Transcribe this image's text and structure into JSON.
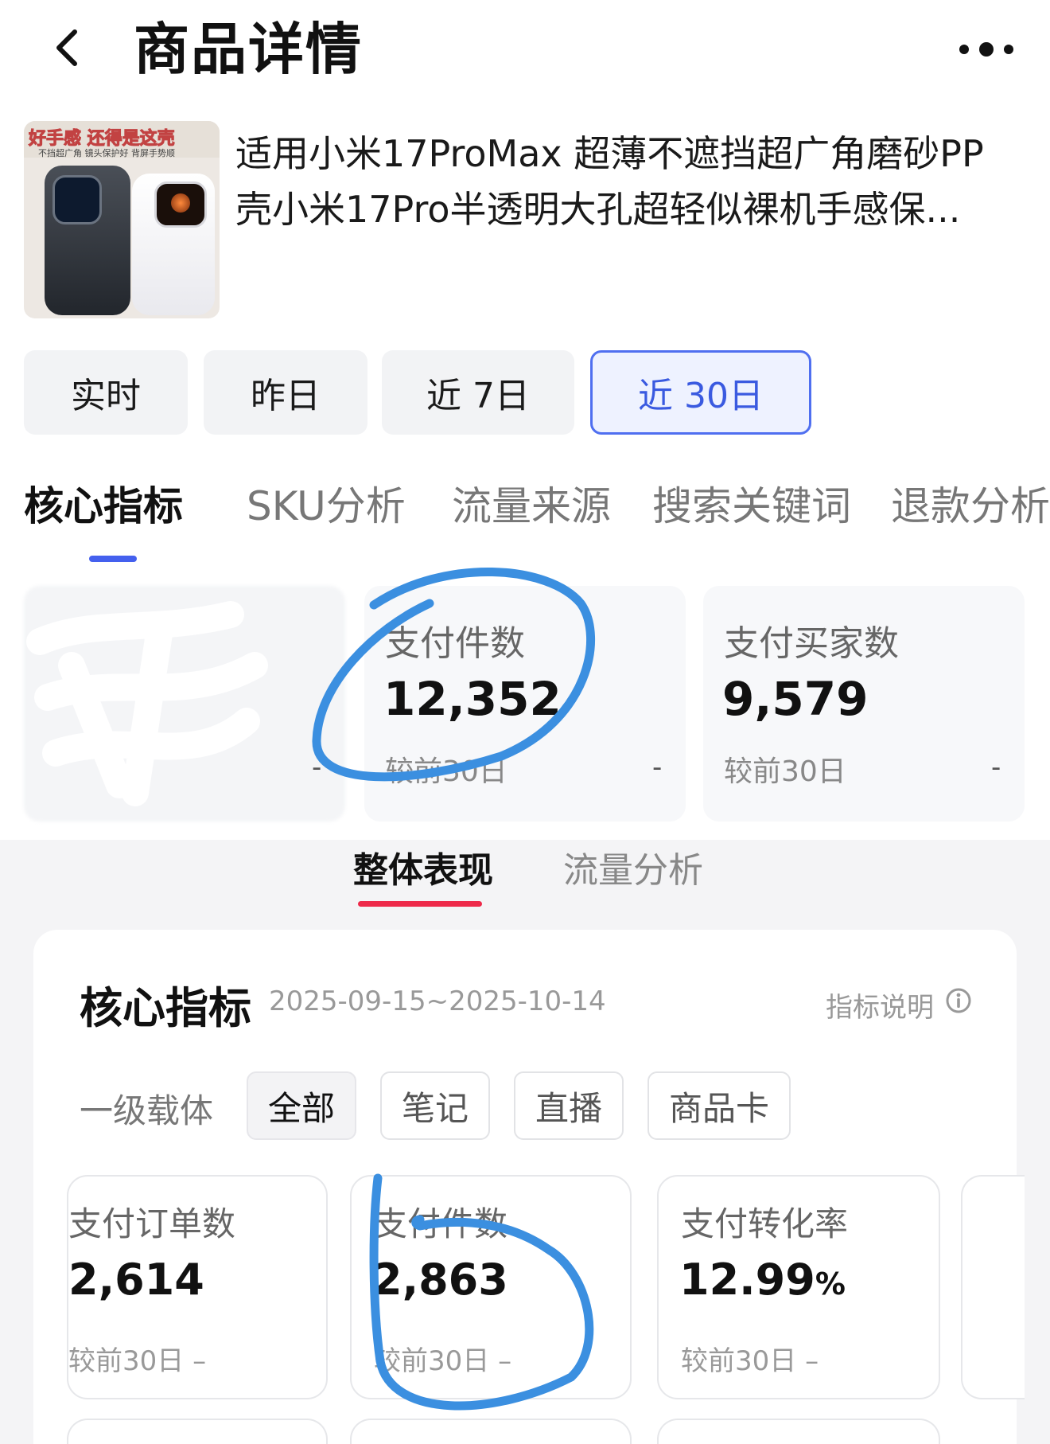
{
  "header": {
    "title": "商品详情"
  },
  "product": {
    "title_line1": "适用小米17ProMax 超薄不遮挡超广角磨砂PP",
    "title_line2": "壳小米17Pro半透明大孔超轻似裸机手感保...",
    "thumb_text1": "好手感 还得是这壳",
    "thumb_text2": "不挡超广角  镜头保护好  背屏手势顺"
  },
  "periods": [
    {
      "label": "实时",
      "active": false
    },
    {
      "label": "昨日",
      "active": false
    },
    {
      "label": "近 7日",
      "active": false
    },
    {
      "label": "近 30日",
      "active": true
    }
  ],
  "section_tabs": [
    {
      "label": "核心指标",
      "active": true
    },
    {
      "label": "SKU分析",
      "active": false
    },
    {
      "label": "流量来源",
      "active": false
    },
    {
      "label": "搜索关键词",
      "active": false
    },
    {
      "label": "退款分析",
      "active": false
    }
  ],
  "top_metrics": [
    {
      "label": "",
      "value": "",
      "compare": "",
      "dash": "-"
    },
    {
      "label": "支付件数",
      "value": "12,352",
      "compare": "较前30日",
      "dash": "-"
    },
    {
      "label": "支付买家数",
      "value": "9,579",
      "compare": "较前30日",
      "dash": "-"
    }
  ],
  "sub_tabs": [
    {
      "label": "整体表现",
      "active": true
    },
    {
      "label": "流量分析",
      "active": false
    }
  ],
  "panel": {
    "title": "核心指标",
    "date_range": "2025-09-15~2025-10-14",
    "help": "指标说明",
    "carrier_label": "一级载体",
    "chips": [
      {
        "label": "全部",
        "active": true
      },
      {
        "label": "笔记",
        "active": false
      },
      {
        "label": "直播",
        "active": false
      },
      {
        "label": "商品卡",
        "active": false
      }
    ],
    "cards": [
      {
        "label": "支付订单数",
        "value": "2,614",
        "unit": "",
        "compare": "较前30日 –"
      },
      {
        "label": "支付件数",
        "value": "2,863",
        "unit": "",
        "compare": "较前30日 –"
      },
      {
        "label": "支付转化率",
        "value": "12.99",
        "unit": "%",
        "compare": "较前30日 –"
      }
    ]
  },
  "colors": {
    "accent_blue": "#4f6ff0",
    "tab_underline": "#4460ee",
    "subtab_underline": "#ee2a4a",
    "annotation": "#3b8fe0"
  }
}
